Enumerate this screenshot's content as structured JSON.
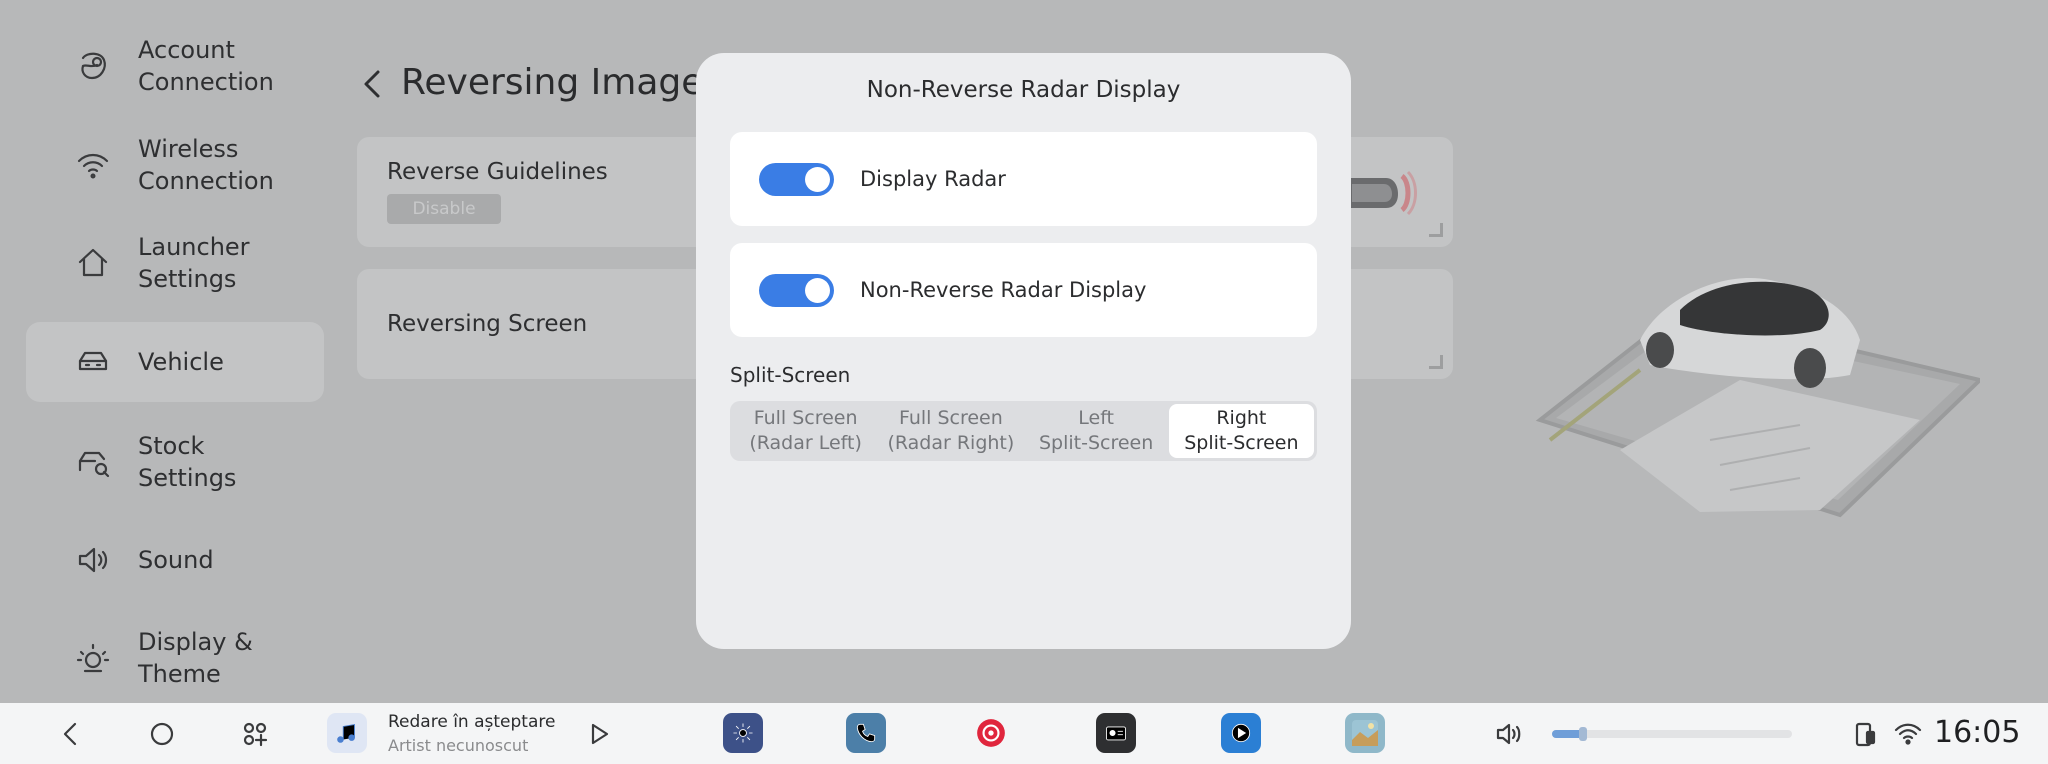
{
  "sidebar": {
    "items": [
      {
        "label": "Account\nConnection",
        "icon": "account-icon"
      },
      {
        "label": "Wireless\nConnection",
        "icon": "wifi-icon"
      },
      {
        "label": "Launcher\nSettings",
        "icon": "home-icon"
      },
      {
        "label": "Vehicle",
        "icon": "car-icon",
        "active": true
      },
      {
        "label": "Stock\nSettings",
        "icon": "car-wrench-icon"
      },
      {
        "label": "Sound",
        "icon": "speaker-icon"
      },
      {
        "label": "Display &\nTheme",
        "icon": "sun-icon"
      }
    ]
  },
  "page": {
    "title": "Reversing Image",
    "reverse_guidelines": {
      "label": "Reverse Guidelines",
      "badge": "Disable"
    },
    "reversing_screen": {
      "label": "Reversing Screen"
    }
  },
  "modal": {
    "title": "Non-Reverse Radar Display",
    "options": [
      {
        "label": "Display Radar",
        "enabled": true
      },
      {
        "label": "Non-Reverse Radar Display",
        "enabled": true
      }
    ],
    "split_screen": {
      "label": "Split-Screen",
      "options": [
        "Full Screen\n(Radar Left)",
        "Full Screen\n(Radar Right)",
        "Left\nSplit-Screen",
        "Right\nSplit-Screen"
      ],
      "selected_index": 3
    }
  },
  "taskbar": {
    "media": {
      "title": "Redare în așteptare",
      "artist": "Artist necunoscut"
    },
    "volume_fraction": 0.13,
    "time": "16:05",
    "apps": [
      "settings-app-icon",
      "phone-app-icon",
      "music-app-icon",
      "radio-app-icon",
      "media-player-app-icon",
      "gallery-app-icon"
    ]
  },
  "colors": {
    "toggle_on": "#3a7de5",
    "overlay_bg": "#b7b8b9",
    "modal_bg": "#ecedef"
  }
}
